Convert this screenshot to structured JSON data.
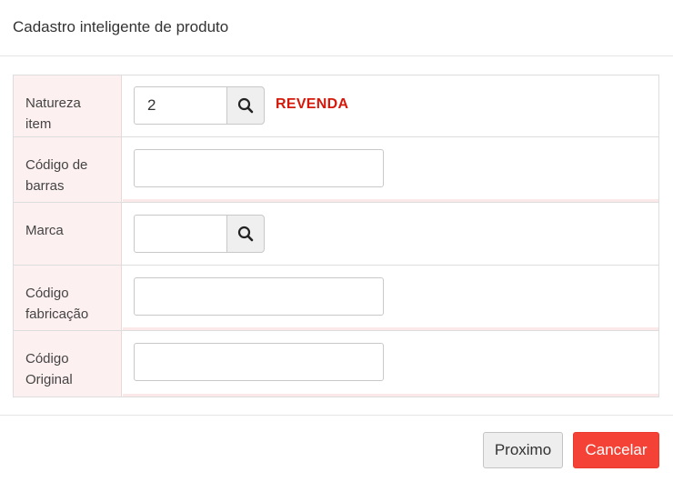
{
  "dialog": {
    "title": "Cadastro inteligente de produto"
  },
  "form": {
    "natureza": {
      "label": "Natureza item",
      "value": "2",
      "description": "REVENDA",
      "search_icon": "search-icon"
    },
    "codigo_barras": {
      "label_line1": "Código de",
      "label_line2": "barras",
      "value": ""
    },
    "marca": {
      "label": "Marca",
      "value": "",
      "search_icon": "search-icon"
    },
    "codigo_fabricacao": {
      "label_line1": "Código",
      "label_line2": "fabricação",
      "value": ""
    },
    "codigo_original": {
      "label_line1": "Código",
      "label_line2": "Original",
      "value": ""
    }
  },
  "footer": {
    "next_label": "Proximo",
    "cancel_label": "Cancelar"
  },
  "colors": {
    "label_background": "#fdf0f0",
    "description_red": "#d6180b",
    "cancel_button": "#f44336",
    "next_button": "#eeeeee"
  }
}
